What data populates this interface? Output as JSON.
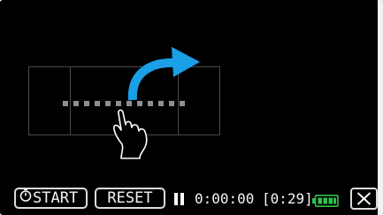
{
  "toolbar": {
    "start_label": "START",
    "reset_label": "RESET",
    "elapsed_time": "0:00:00",
    "remaining_time": "[0:29]",
    "timer_icon": "timer-icon",
    "pause_icon": "pause-icon",
    "battery_icon": "battery-icon",
    "close_icon": "close-icon"
  },
  "preview": {
    "swipe_arrow_icon": "curved-arrow-icon",
    "hand_icon": "hand-pointer-icon"
  },
  "colors": {
    "background": "#000000",
    "foreground": "#f4f4f4",
    "arrow": "#1aa0e6",
    "battery": "#2fc24a",
    "frame_lines": "#4a4a4a"
  }
}
